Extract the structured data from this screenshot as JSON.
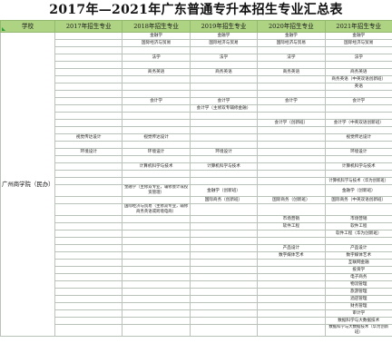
{
  "title": "2017年—2021年广东普通专升本招生专业汇总表",
  "headers": {
    "school": "学校",
    "y2017": "2017年招生专业",
    "y2018": "2018年招生专业",
    "y2019": "2019年招生专业",
    "y2020": "2020年招生专业",
    "y2021": "2021年招生专业"
  },
  "school_name": "广州商学院（民办）",
  "rows": [
    [
      "",
      "金融学",
      "金融学",
      "金融学",
      "金融学"
    ],
    [
      "",
      "国际经济与贸易",
      "国际经济与贸易",
      "国际经济与贸易",
      "国际经济与贸易"
    ],
    [
      "",
      "",
      "",
      "",
      ""
    ],
    [
      "",
      "法学",
      "法学",
      "法学",
      "法学"
    ],
    [
      "",
      "",
      "",
      "",
      ""
    ],
    [
      "",
      "商务英语",
      "商务英语",
      "商务英语",
      "商务英语"
    ],
    [
      "",
      "",
      "",
      "",
      "商务英语（中英双语创新班）"
    ],
    [
      "",
      "",
      "",
      "",
      "英语"
    ],
    [
      "",
      "",
      "",
      "",
      ""
    ],
    [
      "",
      "会计学",
      "会计学",
      "会计学",
      "会计学"
    ],
    [
      "",
      "",
      "会计学（主修双专辅修金融）",
      "",
      ""
    ],
    [
      "",
      "",
      "",
      "",
      ""
    ],
    [
      "",
      "",
      "",
      "会计学（创新班）",
      "会计学（中英双语创新班）"
    ],
    [
      "",
      "",
      "",
      "",
      ""
    ],
    [
      "视觉传达设计",
      "视觉传达设计",
      "",
      "",
      "视觉传达设计"
    ],
    [
      "",
      "",
      "",
      "",
      ""
    ],
    [
      "环境设计",
      "环境设计",
      "环境设计",
      "",
      "环境设计"
    ],
    [
      "",
      "",
      "",
      "",
      ""
    ],
    [
      "",
      "计算机科学与技术",
      "计算机科学与技术",
      "",
      "计算机科学与技术"
    ],
    [
      "",
      "",
      "",
      "",
      ""
    ],
    [
      "",
      "",
      "",
      "",
      "计算机科学与技术（华为创新班）"
    ],
    [
      "",
      "金融学（主修双专业，辅修会计或投资管理）",
      "金融学（创新班）",
      "",
      "金融学（创新班）"
    ],
    [
      "",
      "",
      "国际商务（创新班）",
      "国际商务（创新班）",
      "国际商务（中英双语创新班）"
    ],
    [
      "",
      "国际经济与贸易（主修双专业，辅修商务英语或跨境电商）",
      "",
      "",
      ""
    ],
    [
      "",
      "",
      "",
      "市场营销",
      "市场营销"
    ],
    [
      "",
      "",
      "",
      "软件工程",
      "软件工程"
    ],
    [
      "",
      "",
      "",
      "",
      "软件工程（华为创新班）"
    ],
    [
      "",
      "",
      "",
      "",
      ""
    ],
    [
      "",
      "",
      "",
      "产品设计",
      "产品设计"
    ],
    [
      "",
      "",
      "",
      "数字媒体艺术",
      "数字媒体艺术"
    ],
    [
      "",
      "",
      "",
      "",
      "互联网金融"
    ],
    [
      "",
      "",
      "",
      "",
      "投资学"
    ],
    [
      "",
      "",
      "",
      "",
      "电子商务"
    ],
    [
      "",
      "",
      "",
      "",
      "物流管理"
    ],
    [
      "",
      "",
      "",
      "",
      "旅游管理"
    ],
    [
      "",
      "",
      "",
      "",
      "酒店管理"
    ],
    [
      "",
      "",
      "",
      "",
      "财务管理"
    ],
    [
      "",
      "",
      "",
      "",
      "审计学"
    ],
    [
      "",
      "",
      "",
      "",
      "数据科学与大数据技术"
    ],
    [
      "",
      "",
      "",
      "",
      "数据科学与大数据技术（华为创新班）"
    ]
  ]
}
